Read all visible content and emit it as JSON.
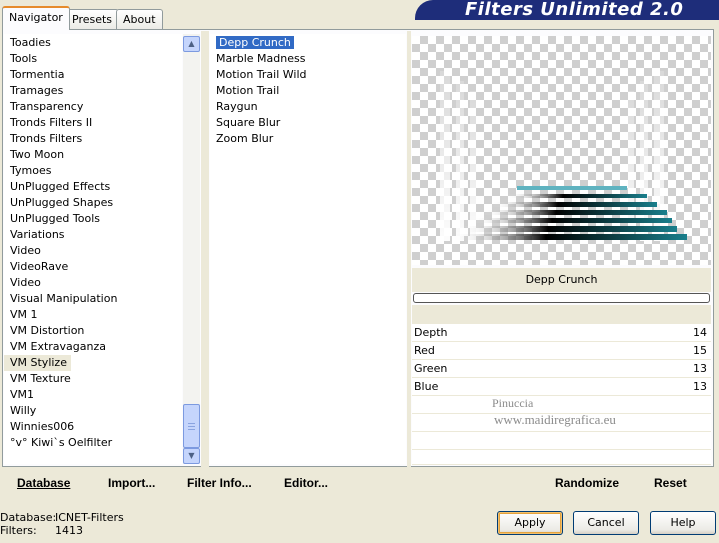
{
  "title": "Filters Unlimited 2.0",
  "tabs": [
    "Navigator",
    "Presets",
    "About"
  ],
  "categories": [
    "Toadies",
    "Tools",
    "Tormentia",
    "Tramages",
    "Transparency",
    "Tronds Filters II",
    "Tronds Filters",
    "Two Moon",
    "Tymoes",
    "UnPlugged Effects",
    "UnPlugged Shapes",
    "UnPlugged Tools",
    "Variations",
    "Video",
    "VideoRave",
    "Video",
    "Visual Manipulation",
    "VM 1",
    "VM Distortion",
    "VM Extravaganza",
    "VM Stylize",
    "VM Texture",
    "VM1",
    "Willy",
    "Winnies006",
    "°v° Kiwi`s Oelfilter"
  ],
  "selected_category": "VM Stylize",
  "filters": [
    "Depp Crunch",
    "Marble Madness",
    "Motion Trail Wild",
    "Motion Trail",
    "Raygun",
    "Square Blur",
    "Zoom Blur"
  ],
  "selected_filter": "Depp Crunch",
  "preview_filter_name": "Depp Crunch",
  "params": [
    {
      "label": "Depth",
      "value": "14"
    },
    {
      "label": "Red",
      "value": "15"
    },
    {
      "label": "Green",
      "value": "13"
    },
    {
      "label": "Blue",
      "value": "13"
    }
  ],
  "links": {
    "database": "Database",
    "import": "Import...",
    "filter_info": "Filter Info...",
    "editor": "Editor...",
    "randomize": "Randomize",
    "reset": "Reset"
  },
  "status": {
    "database_label": "Database:",
    "database_value": "ICNET-Filters",
    "filters_label": "Filters:",
    "filters_value": "1413"
  },
  "buttons": {
    "apply": "Apply",
    "cancel": "Cancel",
    "help": "Help"
  },
  "watermark": {
    "line1": "Pinuccia",
    "line2": "www.maidiregrafica.eu"
  },
  "colors": {
    "selection": "#316ac5",
    "banner": "#1e2d7a",
    "preview_teal": "#1a7f8c"
  }
}
